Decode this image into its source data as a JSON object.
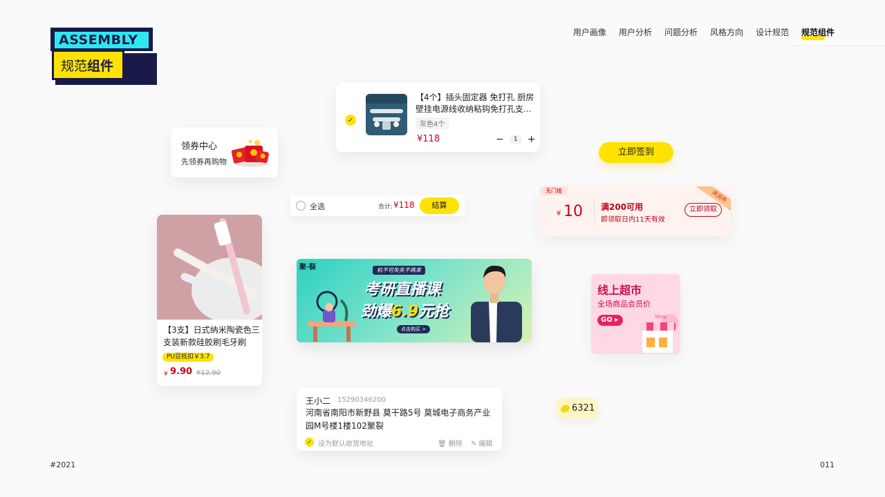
{
  "logo": {
    "top": "ASSEMBLY",
    "bottom_light": "规范",
    "bottom_bold": "组件"
  },
  "nav": {
    "items": [
      "用户画像",
      "用户分析",
      "问题分析",
      "风格方向",
      "设计规范",
      "规范组件"
    ],
    "active_index": 5
  },
  "coupon_center": {
    "title": "领券中心",
    "subtitle": "先领券再购物",
    "icon": "red-envelope-icon"
  },
  "cart_item": {
    "title": "【4个】插头固定器 免打孔 厨房壁挂电源线收纳粘钩免打孔支...",
    "spec": "灰色4个",
    "price": "¥118",
    "quantity": "1",
    "minus": "−",
    "plus": "+",
    "checked": true
  },
  "checkout": {
    "select_all": "全选",
    "total_label": "合计:",
    "total": "¥118",
    "button": "结算"
  },
  "sign_in": {
    "label": "立即签到"
  },
  "coupon": {
    "tag": "无门槛",
    "currency": "¥",
    "amount": "10",
    "condition": "满200可用",
    "validity": "即领取日内11天有效",
    "button": "立即领取",
    "ribbon": "满减券"
  },
  "product": {
    "name": "【3支】日式纳米陶瓷色三支装新款硅胶刷毛牙刷",
    "badge": "PU豆抵扣￥3.7",
    "currency": "¥",
    "price": "9.90",
    "old_price": "¥12.90"
  },
  "banner": {
    "brand": "聚·裂",
    "slogan": "机不可失失不再来",
    "line1": "考研直播课",
    "line2_a": "劲爆",
    "line2_b": "6.9",
    "line2_c": "元抢",
    "button": "点击购买 >"
  },
  "market": {
    "title": "线上超市",
    "subtitle": "全场商品会员价",
    "go": "GO",
    "shop_sign": "Shop"
  },
  "address": {
    "name": "王小二",
    "phone": "15290346200",
    "address": "河南省南阳市新野县 莫干路5号 莫城电子商务产业园M号楼1楼102聚裂",
    "default_label": "设为默认收货地址",
    "delete": "删除",
    "edit": "编辑"
  },
  "points": {
    "value": "6321"
  },
  "footer": {
    "year": "#2021",
    "page": "011"
  },
  "colors": {
    "accent": "#ffe200",
    "price_red": "#d0021b",
    "logo_cyan": "#2ee8f0",
    "logo_navy": "#1a1a4a"
  }
}
